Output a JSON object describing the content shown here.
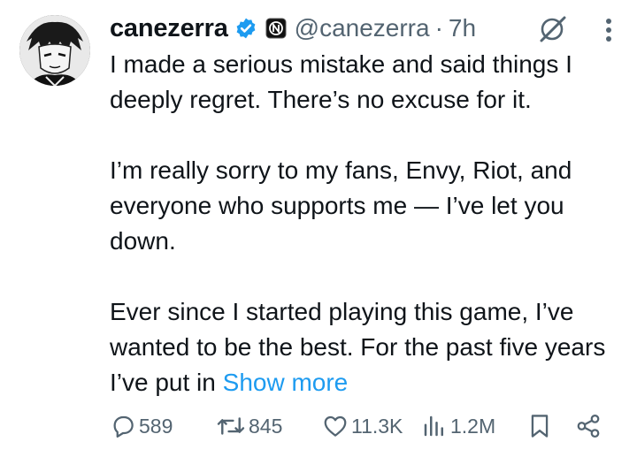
{
  "author": {
    "name": "canezerra",
    "handle": "@canezerra",
    "time_sep": "·",
    "time": "7h"
  },
  "tweet": {
    "paragraphs": [
      "I made a serious mistake and said things I deeply regret. There’s no excuse for it.",
      "I’m really sorry to my fans, Envy, Riot, and everyone who supports me — I’ve let you down.",
      "Ever since I started playing this game, I’ve wanted to be the best. For the past five years I’ve put in"
    ],
    "show_more": "Show more"
  },
  "actions": {
    "replies": "589",
    "reposts": "845",
    "likes": "11.3K",
    "views": "1.2M"
  },
  "colors": {
    "text": "#0f1419",
    "secondary": "#536471",
    "link": "#1d9bf0",
    "verified": "#1d9bf0"
  }
}
